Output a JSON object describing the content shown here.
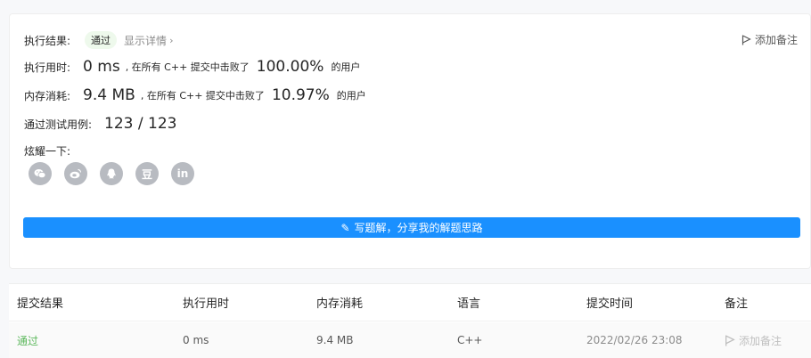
{
  "result": {
    "label": "执行结果:",
    "status": "通过",
    "details_link": "显示详情",
    "chevron": "›",
    "add_note": "添加备注"
  },
  "runtime": {
    "label": "执行用时:",
    "value": "0 ms",
    "prefix": ", 在所有 C++ 提交中击败了",
    "percent": "100.00%",
    "suffix": "的用户"
  },
  "memory": {
    "label": "内存消耗:",
    "value": "9.4 MB",
    "prefix": ", 在所有 C++ 提交中击败了",
    "percent": "10.97%",
    "suffix": "的用户"
  },
  "testcases": {
    "label": "通过测试用例:",
    "value": "123 / 123"
  },
  "share": {
    "label": "炫耀一下:",
    "icons": [
      "wechat-icon",
      "weibo-icon",
      "qq-icon",
      "douban-icon",
      "linkedin-icon"
    ],
    "douban_glyph": "豆",
    "linkedin_glyph": "in"
  },
  "write_solution": {
    "label": "写题解，分享我的解题思路"
  },
  "table": {
    "headers": [
      "提交结果",
      "执行用时",
      "内存消耗",
      "语言",
      "提交时间",
      "备注"
    ],
    "rows": [
      {
        "status": "通过",
        "runtime": "0 ms",
        "memory": "9.4 MB",
        "language": "C++",
        "time": "2022/02/26 23:08",
        "note": "添加备注"
      }
    ]
  },
  "colors": {
    "accent": "#1a90ff",
    "success": "#5cb85c",
    "share_icon_bg": "#b8bbc1"
  }
}
